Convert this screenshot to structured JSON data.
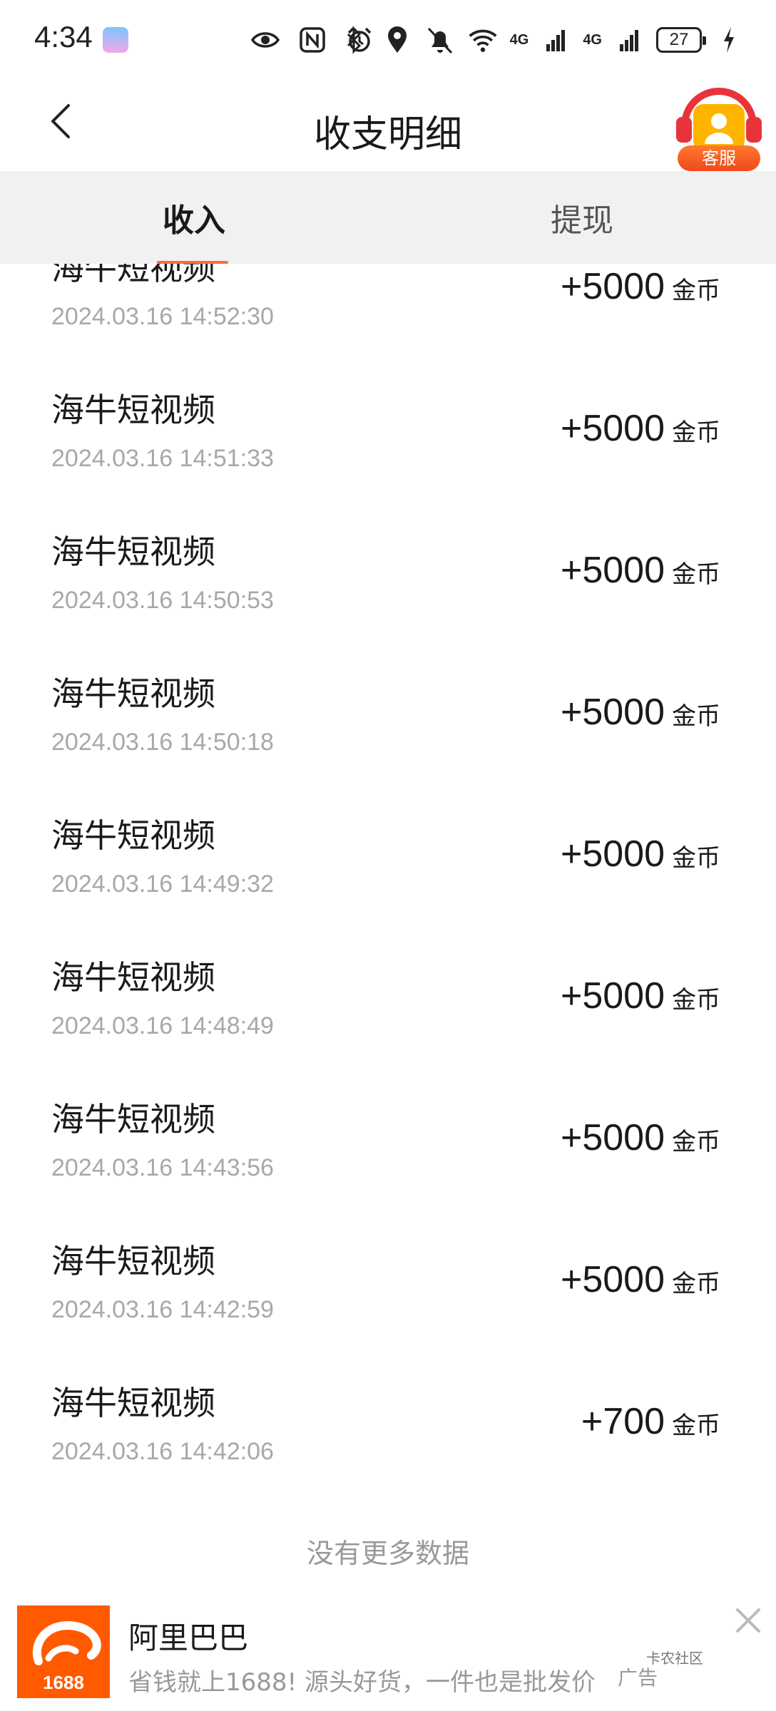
{
  "status_bar": {
    "time": "4:34",
    "network_1": "4G",
    "network_2": "4G",
    "battery": "27",
    "icons": [
      "eye-icon",
      "nfc-icon",
      "alarm-icon",
      "bluetooth-icon",
      "location-icon",
      "bell-mute-icon",
      "wifi-icon",
      "signal-icon",
      "charging-icon"
    ]
  },
  "header": {
    "title": "收支明细",
    "service_label": "客服"
  },
  "tabs": [
    {
      "label": "收入",
      "active": true
    },
    {
      "label": "提现",
      "active": false
    }
  ],
  "records": [
    {
      "name": "海牛短视频",
      "date": "2024.03.16 14:52:30",
      "amount": "+5000",
      "unit": "金币"
    },
    {
      "name": "海牛短视频",
      "date": "2024.03.16 14:51:33",
      "amount": "+5000",
      "unit": "金币"
    },
    {
      "name": "海牛短视频",
      "date": "2024.03.16 14:50:53",
      "amount": "+5000",
      "unit": "金币"
    },
    {
      "name": "海牛短视频",
      "date": "2024.03.16 14:50:18",
      "amount": "+5000",
      "unit": "金币"
    },
    {
      "name": "海牛短视频",
      "date": "2024.03.16 14:49:32",
      "amount": "+5000",
      "unit": "金币"
    },
    {
      "name": "海牛短视频",
      "date": "2024.03.16 14:48:49",
      "amount": "+5000",
      "unit": "金币"
    },
    {
      "name": "海牛短视频",
      "date": "2024.03.16 14:43:56",
      "amount": "+5000",
      "unit": "金币"
    },
    {
      "name": "海牛短视频",
      "date": "2024.03.16 14:42:59",
      "amount": "+5000",
      "unit": "金币"
    },
    {
      "name": "海牛短视频",
      "date": "2024.03.16 14:42:06",
      "amount": "+700",
      "unit": "金币"
    }
  ],
  "footer": {
    "no_more": "没有更多数据"
  },
  "ad": {
    "title": "阿里巴巴",
    "description": "省钱就上1688!  源头好货，一件也是批发价",
    "logo_text": "1688",
    "tag": "广告",
    "watermark": "卡农社区"
  },
  "colors": {
    "accent": "#ff6a3d",
    "tab_bg": "#f1f1f1",
    "ad_logo": "#ff5a00"
  }
}
